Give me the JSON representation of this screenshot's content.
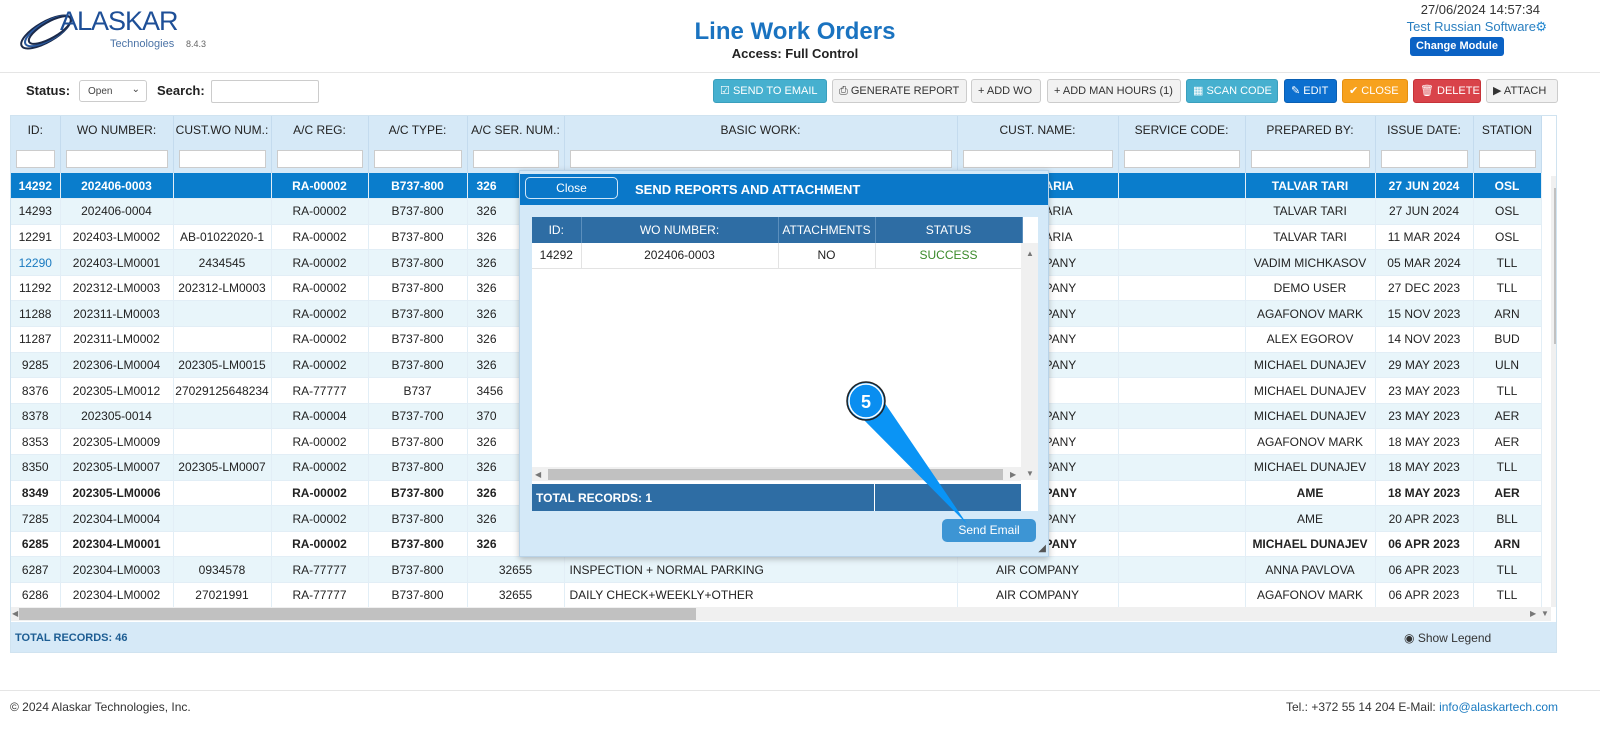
{
  "header": {
    "logo": "ALASKAR",
    "logo_sub": "Technologies",
    "version": "8.4.3",
    "title": "Line Work Orders",
    "access": "Access: Full Control",
    "datetime": "27/06/2024 14:57:34",
    "user": "Test Russian Software",
    "change_module": "Change Module"
  },
  "filters": {
    "status_label": "Status:",
    "status_value": "Open",
    "search_label": "Search:",
    "search_value": ""
  },
  "toolbar": [
    {
      "label": "SEND TO EMAIL",
      "icon": "☑",
      "style": "info"
    },
    {
      "label": "GENERATE REPORT",
      "icon": "⎙",
      "style": "def"
    },
    {
      "label": "ADD WO",
      "icon": "+",
      "style": "def"
    },
    {
      "label": "ADD MAN HOURS (1)",
      "icon": "+",
      "style": "def"
    },
    {
      "label": "SCAN CODE",
      "icon": "▦",
      "style": "info"
    },
    {
      "label": "EDIT",
      "icon": "✎",
      "style": "pri"
    },
    {
      "label": "CLOSE",
      "icon": "✔",
      "style": "warn"
    },
    {
      "label": "DELETE",
      "icon": "🗑",
      "style": "dan"
    },
    {
      "label": "ATTACH",
      "icon": "▶",
      "style": "def"
    }
  ],
  "table": {
    "columns": [
      "ID:",
      "WO NUMBER:",
      "CUST.WO NUM.:",
      "A/C REG:",
      "A/C TYPE:",
      "A/C SER. NUM.:",
      "BASIC WORK:",
      "CUST. NAME:",
      "SERVICE CODE:",
      "PREPARED BY:",
      "ISSUE DATE:",
      "STATION"
    ],
    "rows": [
      [
        "14292",
        "202406-0003",
        "",
        "RA-00002",
        "B737-800",
        "326",
        "",
        "ARIA",
        "",
        "TALVAR TARI",
        "27 JUN 2024",
        "OSL"
      ],
      [
        "14293",
        "202406-0004",
        "",
        "RA-00002",
        "B737-800",
        "326",
        "",
        "ARIA",
        "",
        "TALVAR TARI",
        "27 JUN 2024",
        "OSL"
      ],
      [
        "12291",
        "202403-LM0002",
        "AB-01022020-1",
        "RA-00002",
        "B737-800",
        "326",
        "",
        "ARIA",
        "",
        "TALVAR TARI",
        "11 MAR 2024",
        "OSL"
      ],
      [
        "12290",
        "202403-LM0001",
        "2434545",
        "RA-00002",
        "B737-800",
        "326",
        "",
        "PANY",
        "",
        "VADIM MICHKASOV",
        "05 MAR 2024",
        "TLL"
      ],
      [
        "11292",
        "202312-LM0003",
        "202312-LM0003",
        "RA-00002",
        "B737-800",
        "326",
        "",
        "PANY",
        "",
        "DEMO USER",
        "27 DEC 2023",
        "TLL"
      ],
      [
        "11288",
        "202311-LM0003",
        "",
        "RA-00002",
        "B737-800",
        "326",
        "",
        "PANY",
        "",
        "AGAFONOV MARK",
        "15 NOV 2023",
        "ARN"
      ],
      [
        "11287",
        "202311-LM0002",
        "",
        "RA-00002",
        "B737-800",
        "326",
        "",
        "PANY",
        "",
        "ALEX EGOROV",
        "14 NOV 2023",
        "BUD"
      ],
      [
        "9285",
        "202306-LM0004",
        "202305-LM0015",
        "RA-00002",
        "B737-800",
        "326",
        "",
        "PANY",
        "",
        "MICHAEL DUNAJEV",
        "29 MAY 2023",
        "ULN"
      ],
      [
        "8376",
        "202305-LM0012",
        "27029125648234",
        "RA-77777",
        "B737",
        "3456",
        "",
        "",
        "",
        "MICHAEL DUNAJEV",
        "23 MAY 2023",
        "TLL"
      ],
      [
        "8378",
        "202305-0014",
        "",
        "RA-00004",
        "B737-700",
        "370",
        "",
        "PANY",
        "",
        "MICHAEL DUNAJEV",
        "23 MAY 2023",
        "AER"
      ],
      [
        "8353",
        "202305-LM0009",
        "",
        "RA-00002",
        "B737-800",
        "326",
        "",
        "PANY",
        "",
        "AGAFONOV MARK",
        "18 MAY 2023",
        "AER"
      ],
      [
        "8350",
        "202305-LM0007",
        "202305-LM0007",
        "RA-00002",
        "B737-800",
        "326",
        "",
        "PANY",
        "",
        "MICHAEL DUNAJEV",
        "18 MAY 2023",
        "TLL"
      ],
      [
        "8349",
        "202305-LM0006",
        "",
        "RA-00002",
        "B737-800",
        "326",
        "",
        "PANY",
        "",
        "AME",
        "18 MAY 2023",
        "AER"
      ],
      [
        "7285",
        "202304-LM0004",
        "",
        "RA-00002",
        "B737-800",
        "326",
        "",
        "PANY",
        "",
        "AME",
        "20 APR 2023",
        "BLL"
      ],
      [
        "6285",
        "202304-LM0001",
        "",
        "RA-00002",
        "B737-800",
        "326",
        "",
        "PANY",
        "",
        "MICHAEL DUNAJEV",
        "06 APR 2023",
        "ARN"
      ],
      [
        "6287",
        "202304-LM0003",
        "0934578",
        "RA-77777",
        "B737-800",
        "32655",
        "INSPECTION + NORMAL PARKING",
        "AIR COMPANY",
        "",
        "ANNA PAVLOVA",
        "06 APR 2023",
        "TLL"
      ],
      [
        "6286",
        "202304-LM0002",
        "27021991",
        "RA-77777",
        "B737-800",
        "32655",
        "DAILY CHECK+WEEKLY+OTHER",
        "AIR COMPANY",
        "",
        "AGAFONOV MARK",
        "06 APR 2023",
        "TLL"
      ]
    ],
    "total": "TOTAL RECORDS: 46",
    "show_legend": "Show Legend"
  },
  "modal": {
    "close": "Close",
    "title": "SEND REPORTS AND ATTACHMENT",
    "columns": [
      "ID:",
      "WO NUMBER:",
      "ATTACHMENTS",
      "STATUS"
    ],
    "rows": [
      [
        "14292",
        "202406-0003",
        "NO",
        "SUCCESS"
      ]
    ],
    "total": "TOTAL RECORDS: 1",
    "send": "Send Email"
  },
  "annotation": {
    "step": "5"
  },
  "footer": {
    "copyright": "© 2024 Alaskar Technologies, Inc.",
    "contact": "Tel.: +372 55 14 204 E-Mail:",
    "email": "info@alaskartech.com"
  },
  "colors": {
    "accent": "#0a7dcc",
    "modal_header": "#0a78c9",
    "grid_header": "#2e6da4",
    "success": "#3a8a2a"
  }
}
